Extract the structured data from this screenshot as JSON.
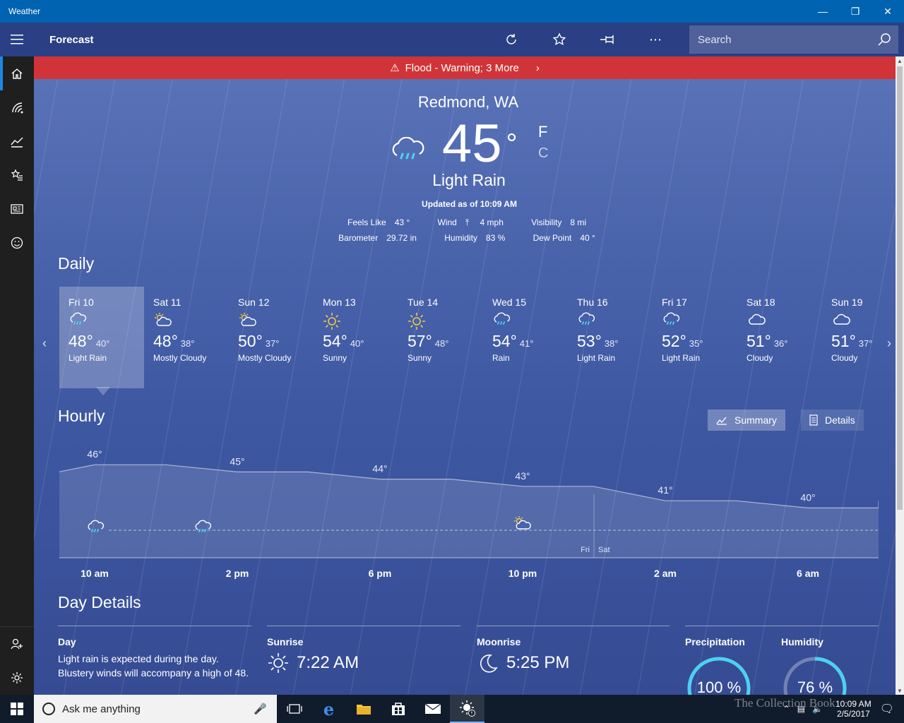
{
  "window": {
    "title": "Weather"
  },
  "header": {
    "title": "Forecast",
    "search_placeholder": "Search"
  },
  "alert": {
    "text": "Flood - Warning; 3 More"
  },
  "current": {
    "city": "Redmond, WA",
    "temp": "45",
    "deg": "°",
    "unit_f": "F",
    "unit_c": "C",
    "condition": "Light Rain",
    "updated": "Updated as of 10:09 AM",
    "feels_like_label": "Feels Like",
    "feels_like": "43 °",
    "wind_label": "Wind",
    "wind": "4 mph",
    "visibility_label": "Visibility",
    "visibility": "8 mi",
    "barometer_label": "Barometer",
    "barometer": "29.72 in",
    "humidity_label": "Humidity",
    "humidity": "83 %",
    "dew_point_label": "Dew Point",
    "dew_point": "40 °"
  },
  "daily": {
    "title": "Daily",
    "days": [
      {
        "name": "Fri 10",
        "hi": "48°",
        "lo": "40°",
        "cond": "Light Rain",
        "icon": "rain-cloud-icon"
      },
      {
        "name": "Sat 11",
        "hi": "48°",
        "lo": "38°",
        "cond": "Mostly Cloudy",
        "icon": "partly-sunny-icon"
      },
      {
        "name": "Sun 12",
        "hi": "50°",
        "lo": "37°",
        "cond": "Mostly Cloudy",
        "icon": "partly-sunny-icon"
      },
      {
        "name": "Mon 13",
        "hi": "54°",
        "lo": "40°",
        "cond": "Sunny",
        "icon": "sun-icon"
      },
      {
        "name": "Tue 14",
        "hi": "57°",
        "lo": "48°",
        "cond": "Sunny",
        "icon": "sun-icon"
      },
      {
        "name": "Wed 15",
        "hi": "54°",
        "lo": "41°",
        "cond": "Rain",
        "icon": "rain-cloud-icon"
      },
      {
        "name": "Thu 16",
        "hi": "53°",
        "lo": "38°",
        "cond": "Light Rain",
        "icon": "rain-cloud-icon"
      },
      {
        "name": "Fri 17",
        "hi": "52°",
        "lo": "35°",
        "cond": "Light Rain",
        "icon": "rain-cloud-icon"
      },
      {
        "name": "Sat 18",
        "hi": "51°",
        "lo": "36°",
        "cond": "Cloudy",
        "icon": "cloud-icon"
      },
      {
        "name": "Sun 19",
        "hi": "51°",
        "lo": "37°",
        "cond": "Cloudy",
        "icon": "cloud-icon"
      }
    ]
  },
  "hourly": {
    "title": "Hourly",
    "summary_label": "Summary",
    "details_label": "Details",
    "temps": [
      {
        "label": "46°",
        "value": 46
      },
      {
        "label": "45°",
        "value": 45
      },
      {
        "label": "44°",
        "value": 44
      },
      {
        "label": "43°",
        "value": 43
      },
      {
        "label": "41°",
        "value": 41
      },
      {
        "label": "40°",
        "value": 40
      }
    ],
    "times": [
      "10 am",
      "2 pm",
      "6 pm",
      "10 pm",
      "2 am",
      "6 am"
    ],
    "day_split": [
      "Fri",
      "Sat"
    ]
  },
  "day_details": {
    "title": "Day Details",
    "day_label": "Day",
    "day_text": "Light rain is expected during the day. Blustery winds will accompany a high of 48.",
    "sunrise_label": "Sunrise",
    "sunrise": "7:22 AM",
    "moonrise_label": "Moonrise",
    "moonrise": "5:25 PM",
    "precip_label": "Precipitation",
    "precip": "100 %",
    "humidity_label": "Humidity",
    "humidity": "76 %"
  },
  "taskbar": {
    "search_placeholder": "Ask me anything",
    "time": "10:09 AM",
    "date": "2/5/2017"
  },
  "watermark": "The Collection Book",
  "colors": {
    "accent": "#0063b1",
    "alert": "#d13438",
    "gauge": "#4fd0f0"
  }
}
